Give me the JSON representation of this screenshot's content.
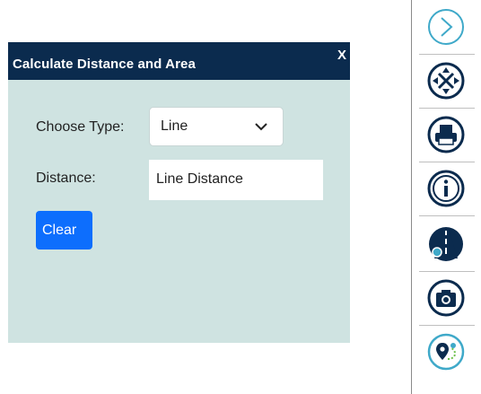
{
  "dialog": {
    "title": "Calculate Distance and Area",
    "close_label": "X",
    "type_label": "Choose Type:",
    "type_value": "Line",
    "distance_label": "Distance:",
    "distance_value": "Line Distance",
    "clear_label": "Clear",
    "colors": {
      "header": "#0b2b4e",
      "body": "#cfe3e1",
      "primary_button": "#0d6efd"
    }
  },
  "toolbar": {
    "tools": [
      {
        "name": "collapse-arrow-icon",
        "glyph": "chevron-right"
      },
      {
        "name": "pan-icon",
        "glyph": "four-way-arrows"
      },
      {
        "name": "print-icon",
        "glyph": "printer"
      },
      {
        "name": "info-icon",
        "glyph": "info"
      },
      {
        "name": "measure-road-icon",
        "glyph": "road-with-ruler"
      },
      {
        "name": "screenshot-icon",
        "glyph": "camera"
      },
      {
        "name": "route-icon",
        "glyph": "map-pin-route"
      }
    ],
    "colors": {
      "outline_light": "#3fa9c9",
      "icon_dark": "#0b2b4e"
    }
  }
}
